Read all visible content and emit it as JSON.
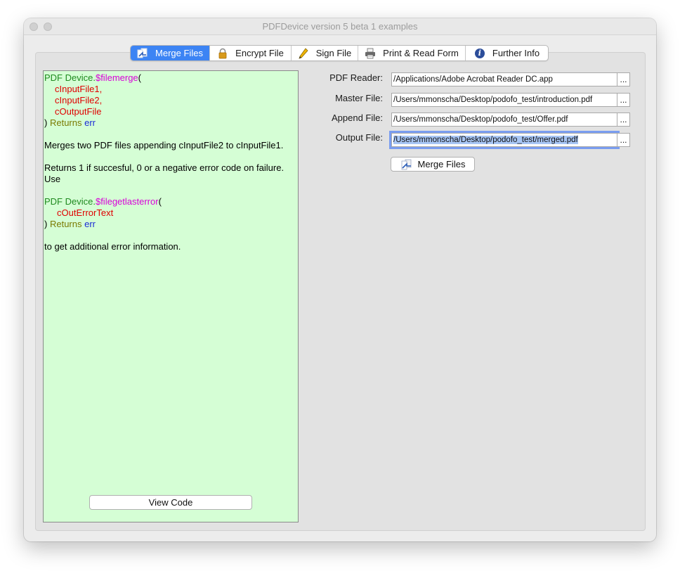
{
  "window": {
    "title": "PDFDevice version 5 beta 1 examples"
  },
  "tabs": [
    {
      "label": "Merge Files",
      "icon": "merge-icon",
      "active": true
    },
    {
      "label": "Encrypt File",
      "icon": "lock-icon",
      "active": false
    },
    {
      "label": "Sign File",
      "icon": "pen-icon",
      "active": false
    },
    {
      "label": "Print & Read Form",
      "icon": "printer-icon",
      "active": false
    },
    {
      "label": "Further Info",
      "icon": "info-icon",
      "active": false
    }
  ],
  "code": {
    "l1_obj": "PDF Device.",
    "l1_fn": "$filemerge",
    "l1_paren": "(",
    "param1": "cInputFile1,",
    "param2": "cInputFile2,",
    "param3": "cOutputFile",
    "close_paren": ")",
    "returns": "Returns",
    "err": "err",
    "desc1": "Merges two PDF files appending cInputFile2 to cInputFile1.",
    "desc2": "Returns 1 if succesful, 0 or a negative error code on failure.",
    "desc3": "Use",
    "l2_obj": "PDF Device.",
    "l2_fn": "$filegetlasterror",
    "l2_paren": "(",
    "param4": "cOutErrorText",
    "close_paren2": ")",
    "returns2": "Returns",
    "err2": "err",
    "desc4": "to get additional error information.",
    "view_code_label": "View Code"
  },
  "colors": {
    "code_bg": "#d5fed5",
    "accent": "#3c84f4",
    "object": "#1f8a1f",
    "function": "#d800d8",
    "param": "#e00000",
    "keyword": "#7a7a00",
    "return_var": "#1b2bd6"
  },
  "form": {
    "pdf_reader_label": "PDF Reader:",
    "pdf_reader_value": "/Applications/Adobe Acrobat Reader DC.app",
    "master_label": "Master File:",
    "master_value": "/Users/mmonscha/Desktop/podofo_test/introduction.pdf",
    "append_label": "Append File:",
    "append_value": "/Users/mmonscha/Desktop/podofo_test/Offer.pdf",
    "output_label": "Output File:",
    "output_value": "/Users/mmonscha/Desktop/podofo_test/merged.pdf",
    "browse_label": "...",
    "merge_button_label": "Merge Files"
  }
}
